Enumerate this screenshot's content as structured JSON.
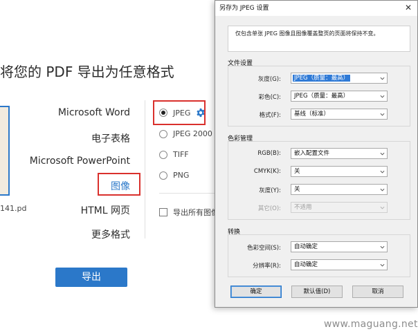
{
  "background": {
    "heading": "将您的 PDF 导出为任意格式",
    "file_name": "141.pd",
    "formats": [
      {
        "label": "Microsoft Word"
      },
      {
        "label": "电子表格"
      },
      {
        "label": "Microsoft PowerPoint"
      },
      {
        "label": "图像"
      },
      {
        "label": "HTML 网页"
      },
      {
        "label": "更多格式"
      }
    ],
    "selected_format": "图像",
    "image_types": [
      {
        "label": "JPEG",
        "selected": true
      },
      {
        "label": "JPEG 2000",
        "selected": false
      },
      {
        "label": "TIFF",
        "selected": false
      },
      {
        "label": "PNG",
        "selected": false
      }
    ],
    "export_all_images": "导出所有图像",
    "export_button": "导出"
  },
  "dialog": {
    "title": "另存为 JPEG 设置",
    "close_glyph": "✕",
    "info_text": "仅包含单张 JPEG 图像且图像覆盖整页的页面将保持不变。",
    "file_settings": {
      "label": "文件设置",
      "grayscale_label": "灰度(G):",
      "grayscale_value": "JPEG（质量：最高）",
      "color_label": "彩色(C):",
      "color_value": "JPEG（质量：最高）",
      "format_label": "格式(F):",
      "format_value": "基线（标准）"
    },
    "color_management": {
      "label": "色彩管理",
      "rgb_label": "RGB(B):",
      "rgb_value": "嵌入配置文件",
      "cmyk_label": "CMYK(K):",
      "cmyk_value": "关",
      "gray_label": "灰度(Y):",
      "gray_value": "关",
      "other_label": "其它(O):",
      "other_value": "不适用"
    },
    "conversion": {
      "label": "转换",
      "colorspace_label": "色彩空间(S):",
      "colorspace_value": "自动确定",
      "resolution_label": "分辨率(R):",
      "resolution_value": "自动确定"
    },
    "buttons": {
      "ok": "确定",
      "defaults": "默认值(D)",
      "cancel": "取消"
    }
  },
  "watermark": "www.maguang.net",
  "colors": {
    "accent": "#2b78c9",
    "highlight_box": "#d9302c",
    "selection": "#2f7ad6"
  }
}
